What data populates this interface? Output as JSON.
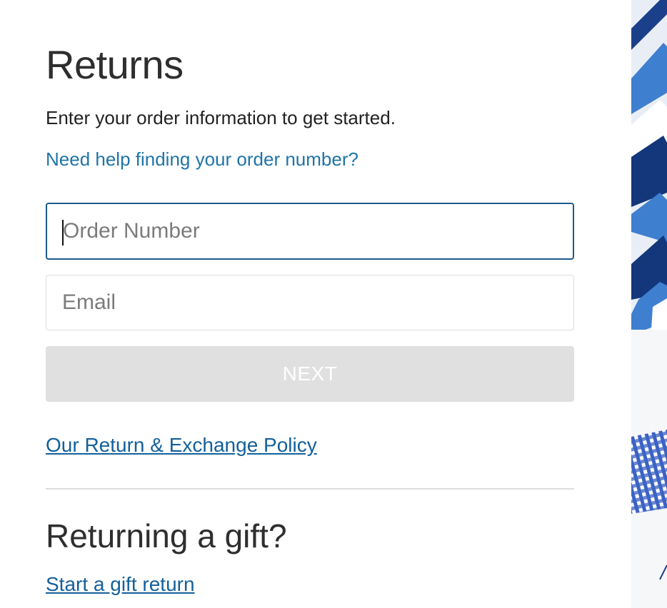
{
  "returns_form": {
    "title": "Returns",
    "subtitle": "Enter your order information to get started.",
    "help_link": "Need help finding your order number?",
    "order_number": {
      "value": "",
      "placeholder": "Order Number"
    },
    "email": {
      "value": "",
      "placeholder": "Email"
    },
    "next_label": "NEXT",
    "policy_link": "Our Return & Exchange Policy"
  },
  "gift_section": {
    "title": "Returning a gift?",
    "link": "Start a gift return"
  },
  "colors": {
    "link": "#1f74a8",
    "focus_border": "#1d5a8c",
    "button_disabled": "#e0e0e0",
    "image_navy": "#14367a",
    "image_blue": "#3f7fcf"
  }
}
